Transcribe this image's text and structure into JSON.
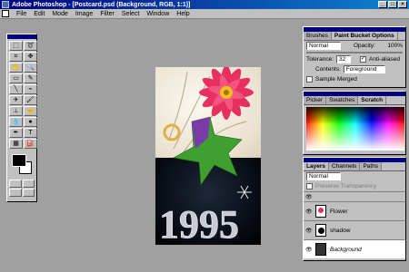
{
  "window": {
    "title": "Adobe Photoshop - [Postcard.psd  (Background, RGB, 1:1)]"
  },
  "menubar": {
    "items": [
      "File",
      "Edit",
      "Mode",
      "Image",
      "Filter",
      "Select",
      "Window",
      "Help"
    ]
  },
  "toolbox": {
    "tools": [
      "marquee",
      "lasso",
      "crop",
      "move",
      "hand",
      "zoom",
      "eraser",
      "pencil",
      "line",
      "eyedropper",
      "airbrush",
      "paintbrush",
      "rubber-stamp",
      "smudge",
      "blur",
      "dodge",
      "pen",
      "type",
      "gradient",
      "paint-bucket"
    ]
  },
  "document": {
    "year_text": "1995"
  },
  "options_palette": {
    "tabs": [
      "Brushes",
      "Paint Bucket Options"
    ],
    "mode": "Normal",
    "opacity_label": "Opacity:",
    "opacity_value": "100%",
    "tolerance_label": "Tolerance:",
    "tolerance_value": "32",
    "anti_aliased": "Anti-aliased",
    "contents_label": "Contents:",
    "contents_value": "Foreground",
    "sample_merged": "Sample Merged"
  },
  "color_palette": {
    "tabs": [
      "Picker",
      "Swatches",
      "Scratch"
    ]
  },
  "layers_palette": {
    "tabs": [
      "Layers",
      "Channels",
      "Paths"
    ],
    "mode": "Normal",
    "preserve_transparency": "Preserve Transparency",
    "layers": [
      {
        "name": ""
      },
      {
        "name": "Flower"
      },
      {
        "name": "shadow"
      },
      {
        "name": "Background"
      }
    ]
  }
}
